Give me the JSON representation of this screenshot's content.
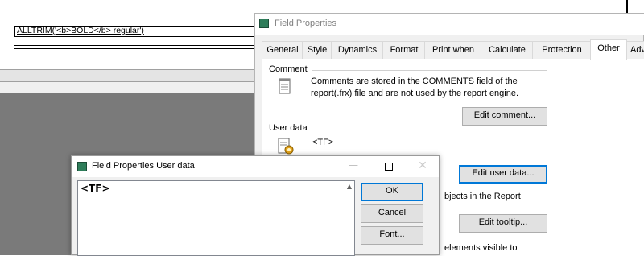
{
  "designer": {
    "field_expression": "ALLTRIM('<b>BOLD</b> regular')"
  },
  "field_properties": {
    "title": "Field Properties",
    "tabs": [
      {
        "label": "General"
      },
      {
        "label": "Style"
      },
      {
        "label": "Dynamics"
      },
      {
        "label": "Format"
      },
      {
        "label": "Print when"
      },
      {
        "label": "Calculate"
      },
      {
        "label": "Protection"
      },
      {
        "label": "Other",
        "active": true
      },
      {
        "label": "Adv"
      }
    ],
    "comment": {
      "label": "Comment",
      "text_line1": "Comments are stored in the COMMENTS field of the",
      "text_line2": "report(.frx) file and are not used by the report engine.",
      "button": "Edit comment..."
    },
    "user_data": {
      "label": "User data",
      "value": "<TF>",
      "button": "Edit user data..."
    },
    "tooltip": {
      "partial_text": "bjects in the Report",
      "button": "Edit tooltip..."
    },
    "partial_text2": "elements visible to"
  },
  "user_data_dialog": {
    "title": "Field Properties User data",
    "text_value": "<TF>",
    "buttons": {
      "ok": "OK",
      "cancel": "Cancel",
      "font": "Font..."
    },
    "controls": {
      "minimize": "—",
      "close": "✕"
    }
  }
}
